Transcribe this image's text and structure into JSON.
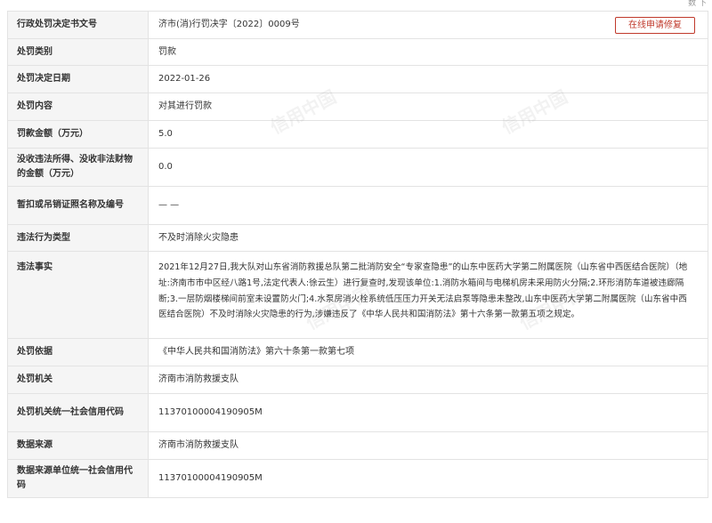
{
  "corner_text": "数 下",
  "rows": [
    {
      "label": "行政处罚决定书文号",
      "value": "济市(消)行罚决字〔2022〕0009号"
    },
    {
      "label": "处罚类别",
      "value": "罚款"
    },
    {
      "label": "处罚决定日期",
      "value": "2022-01-26"
    },
    {
      "label": "处罚内容",
      "value": "对其进行罚款"
    },
    {
      "label": "罚款金额（万元）",
      "value": "5.0"
    },
    {
      "label": "没收违法所得、没收非法财物的金额（万元）",
      "value": "0.0"
    },
    {
      "label": "暂扣或吊销证照名称及编号",
      "value": "— —"
    },
    {
      "label": "违法行为类型",
      "value": "不及时消除火灾隐患"
    },
    {
      "label": "违法事实",
      "value": "2021年12月27日,我大队对山东省消防救援总队第二批消防安全“专家查隐患”的山东中医药大学第二附属医院（山东省中西医结合医院）（地址:济南市市中区经八路1号,法定代表人:徐云生）进行复查时,发现该单位:1.消防水箱间与电梯机房未采用防火分隔;2.环形消防车道被违廊隔断;3.一层防烟楼梯间前室未设置防火门;4.水泵房消火栓系统低压压力开关无法启泵等隐患未整改,山东中医药大学第二附属医院（山东省中西医结合医院）不及时消除火灾隐患的行为,涉嫌违反了《中华人民共和国消防法》第十六条第一款第五项之规定。"
    },
    {
      "label": "处罚依据",
      "value": "《中华人民共和国消防法》第六十条第一款第七项"
    },
    {
      "label": "处罚机关",
      "value": "济南市消防救援支队"
    },
    {
      "label": "处罚机关统一社会信用代码",
      "value": "11370100004190905M"
    },
    {
      "label": "数据来源",
      "value": "济南市消防救援支队"
    },
    {
      "label": "数据来源单位统一社会信用代码",
      "value": "11370100004190905M"
    }
  ],
  "repair_button": "在线申请修复",
  "watermark": "信用中国"
}
